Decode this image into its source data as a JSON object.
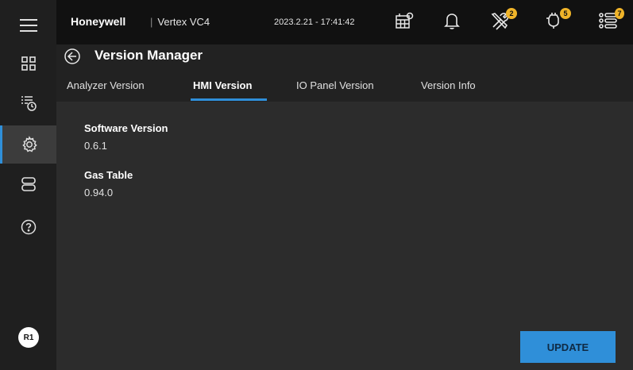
{
  "topbar": {
    "brand": "Honeywell",
    "separator": "|",
    "product": "Vertex VC4",
    "datetime": "2023.2.21 - 17:41:42",
    "tools_badge": "2",
    "maintenance_badge": "5",
    "alarms_badge": "7"
  },
  "page": {
    "title": "Version Manager"
  },
  "tabs": [
    {
      "label": "Analyzer Version"
    },
    {
      "label": "HMI Version"
    },
    {
      "label": "IO Panel Version"
    },
    {
      "label": "Version Info"
    }
  ],
  "main": {
    "software_label": "Software Version",
    "software_value": "0.6.1",
    "gas_label": "Gas Table",
    "gas_value": "0.94.0"
  },
  "buttons": {
    "update": "UPDATE"
  },
  "user": {
    "initials": "R1"
  },
  "colors": {
    "accent": "#2f8fd9",
    "badge": "#f0b429"
  }
}
